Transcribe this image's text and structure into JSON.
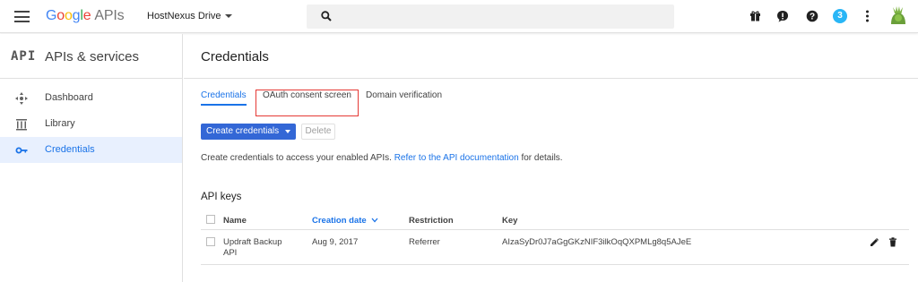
{
  "header": {
    "logo_letters": [
      "G",
      "o",
      "o",
      "g",
      "l",
      "e"
    ],
    "logo_suffix": "APIs",
    "project_name": "HostNexus Drive",
    "notification_count": "3"
  },
  "sidebar": {
    "api_logo": "API",
    "title": "APIs & services",
    "items": [
      {
        "label": "Dashboard",
        "icon": "dashboard-icon"
      },
      {
        "label": "Library",
        "icon": "library-icon"
      },
      {
        "label": "Credentials",
        "icon": "key-icon",
        "active": true
      }
    ]
  },
  "main": {
    "title": "Credentials",
    "tabs": [
      {
        "label": "Credentials",
        "active": true
      },
      {
        "label": "OAuth consent screen",
        "highlighted": true
      },
      {
        "label": "Domain verification"
      }
    ],
    "create_button": "Create credentials",
    "delete_button": "Delete",
    "help_text_before": "Create credentials to access your enabled APIs. ",
    "help_link": "Refer to the API documentation",
    "help_text_after": " for details.",
    "section_title": "API keys",
    "table": {
      "columns": [
        "Name",
        "Creation date",
        "Restriction",
        "Key"
      ],
      "sorted_column": "Creation date",
      "rows": [
        {
          "name_line1": "Updraft Backup",
          "name_line2": "API",
          "date": "Aug 9, 2017",
          "restriction": "Referrer",
          "key": "AIzaSyDr0J7aGgGKzNIF3ilkOqQXPMLg8q5AJeE"
        }
      ]
    }
  },
  "colors": {
    "accent": "#1a73e8",
    "primary_button": "#3367d6",
    "highlight_outline": "#e53935",
    "active_sidebar_bg": "#e8f0fe"
  }
}
